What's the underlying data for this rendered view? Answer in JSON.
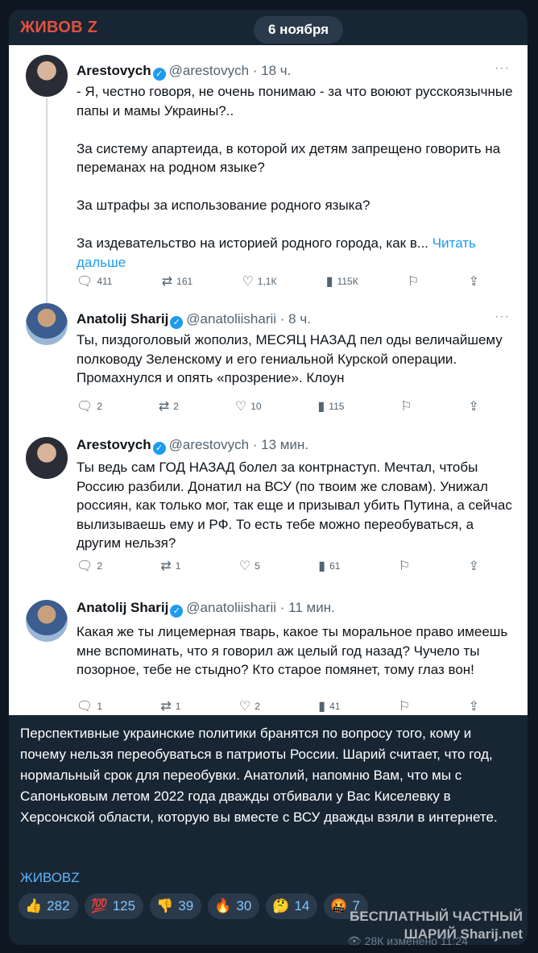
{
  "channel": {
    "name": "ЖИВОВ Z",
    "date": "6 ноября"
  },
  "tweets": [
    {
      "name": "Arestovych",
      "handle": "@arestovych · 18 ч.",
      "lines": [
        "- Я, честно говоря, не очень понимаю - за что воюют русскоязычные папы и мамы Украины?..",
        "За систему апартеида, в которой их детям запрещено говорить на переманах на родном языке?",
        "За штрафы за использование родного языка?",
        "За издевательство на историей родного города, как в..."
      ],
      "more_link": "Читать дальше",
      "replies": "411",
      "retweets": "161",
      "likes": "1,1К",
      "views": "115К"
    },
    {
      "name": "Anatolij Sharij",
      "handle": "@anatoliisharii · 8 ч.",
      "lines": [
        "Ты, пиздоголовый жополиз, МЕСЯЦ НАЗАД пел оды величайшему полководу Зеленскому и его гениальной Курской операции. Промахнулся и опять «прозрение». Клоун"
      ],
      "replies": "2",
      "retweets": "2",
      "likes": "10",
      "views": "115"
    },
    {
      "name": "Arestovych",
      "handle": "@arestovych · 13 мин.",
      "lines": [
        "Ты ведь сам ГОД НАЗАД болел за контрнаступ. Мечтал, чтобы Россию разбили. Донатил на ВСУ (по твоим же словам). Унижал россиян, как только мог, так еще и призывал убить Путина, а сейчас вылизываешь ему и РФ. То есть тебе можно переобуваться, а другим нельзя?"
      ],
      "replies": "2",
      "retweets": "1",
      "likes": "5",
      "views": "61"
    },
    {
      "name": "Anatolij Sharij",
      "handle": "@anatoliisharii · 11 мин.",
      "lines": [
        "Какая же ты лицемерная тварь, какое ты моральное право имеешь мне вспоминать, что я говорил аж целый год назад? Чучело ты позорное, тебе не стыдно? Кто старое помянет, тому глаз вон!"
      ],
      "replies": "1",
      "retweets": "1",
      "likes": "2",
      "views": "41"
    }
  ],
  "caption": "Перспективные украинские политики бранятся по вопросу того, кому и почему нельзя переобуваться в патриоты России. Шарий считает, что год, нормальный срок для переобувки. Анатолий, напомню Вам, что мы с Сапоньковым летом 2022 года дважды отбивали у Вас Киселевку в Херсонской области, которую вы вместе с ВСУ дважды взяли в интернете.",
  "signature": "ЖИВОВZ",
  "reactions": [
    {
      "emoji": "👍",
      "count": "282"
    },
    {
      "emoji": "💯",
      "count": "125"
    },
    {
      "emoji": "👎",
      "count": "39"
    },
    {
      "emoji": "🔥",
      "count": "30"
    },
    {
      "emoji": "🤔",
      "count": "14"
    },
    {
      "emoji": "🤬",
      "count": "7"
    }
  ],
  "watermark": {
    "line1": "БЕСПЛАТНЫЙ ЧАСТНЫЙ",
    "line2": "ШАРИЙ Sharij.net"
  },
  "views_text": "28К изменено 11:24"
}
